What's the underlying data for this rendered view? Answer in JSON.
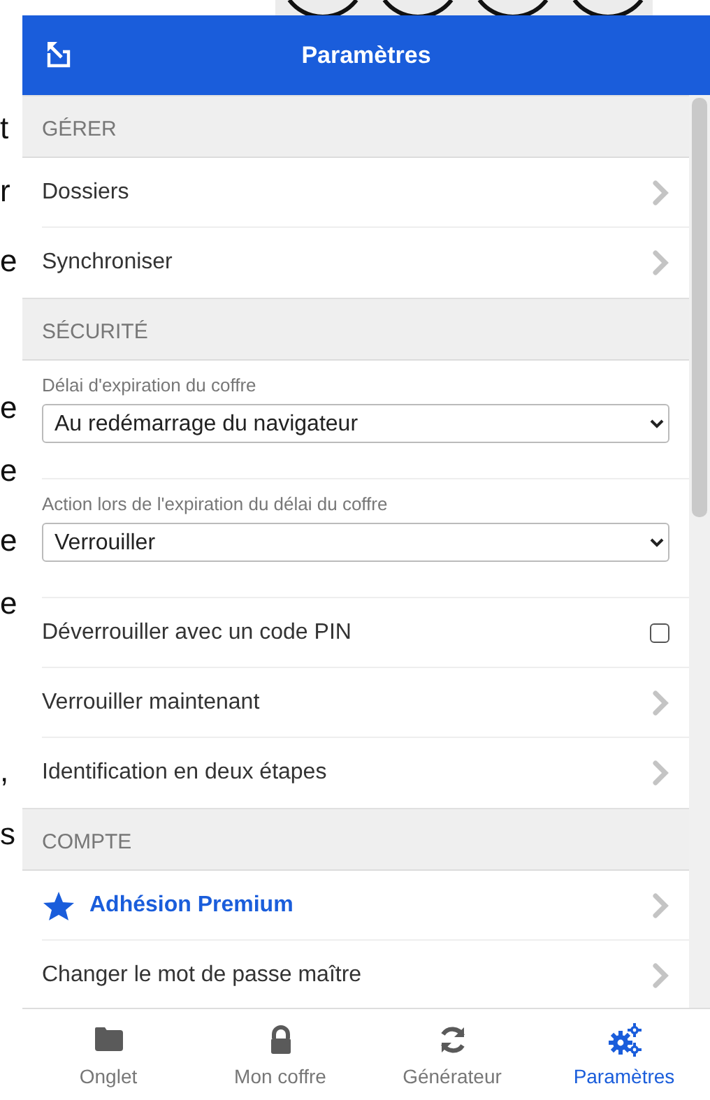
{
  "backdrop": {
    "text_fragments": [
      "t",
      "r",
      "e",
      "e",
      "e",
      "e",
      "e",
      ",",
      "s"
    ]
  },
  "header": {
    "title": "Paramètres"
  },
  "sections": [
    {
      "title": "GÉRER",
      "items": [
        {
          "kind": "link",
          "label": "Dossiers"
        },
        {
          "kind": "link",
          "label": "Synchroniser"
        }
      ]
    },
    {
      "title": "SÉCURITÉ",
      "items": [
        {
          "kind": "select",
          "label": "Délai d'expiration du coffre",
          "value": "Au redémarrage du navigateur"
        },
        {
          "kind": "select",
          "label": "Action lors de l'expiration du délai du coffre",
          "value": "Verrouiller"
        },
        {
          "kind": "checkbox",
          "label": "Déverrouiller avec un code PIN",
          "checked": false
        },
        {
          "kind": "link",
          "label": "Verrouiller maintenant"
        },
        {
          "kind": "link",
          "label": "Identification en deux étapes"
        }
      ]
    },
    {
      "title": "COMPTE",
      "items": [
        {
          "kind": "premium",
          "label": "Adhésion Premium"
        },
        {
          "kind": "link",
          "label": "Changer le mot de passe maître"
        }
      ]
    }
  ],
  "tabs": [
    {
      "label": "Onglet",
      "selected": false
    },
    {
      "label": "Mon coffre",
      "selected": false
    },
    {
      "label": "Générateur",
      "selected": false
    },
    {
      "label": "Paramètres",
      "selected": true
    }
  ]
}
